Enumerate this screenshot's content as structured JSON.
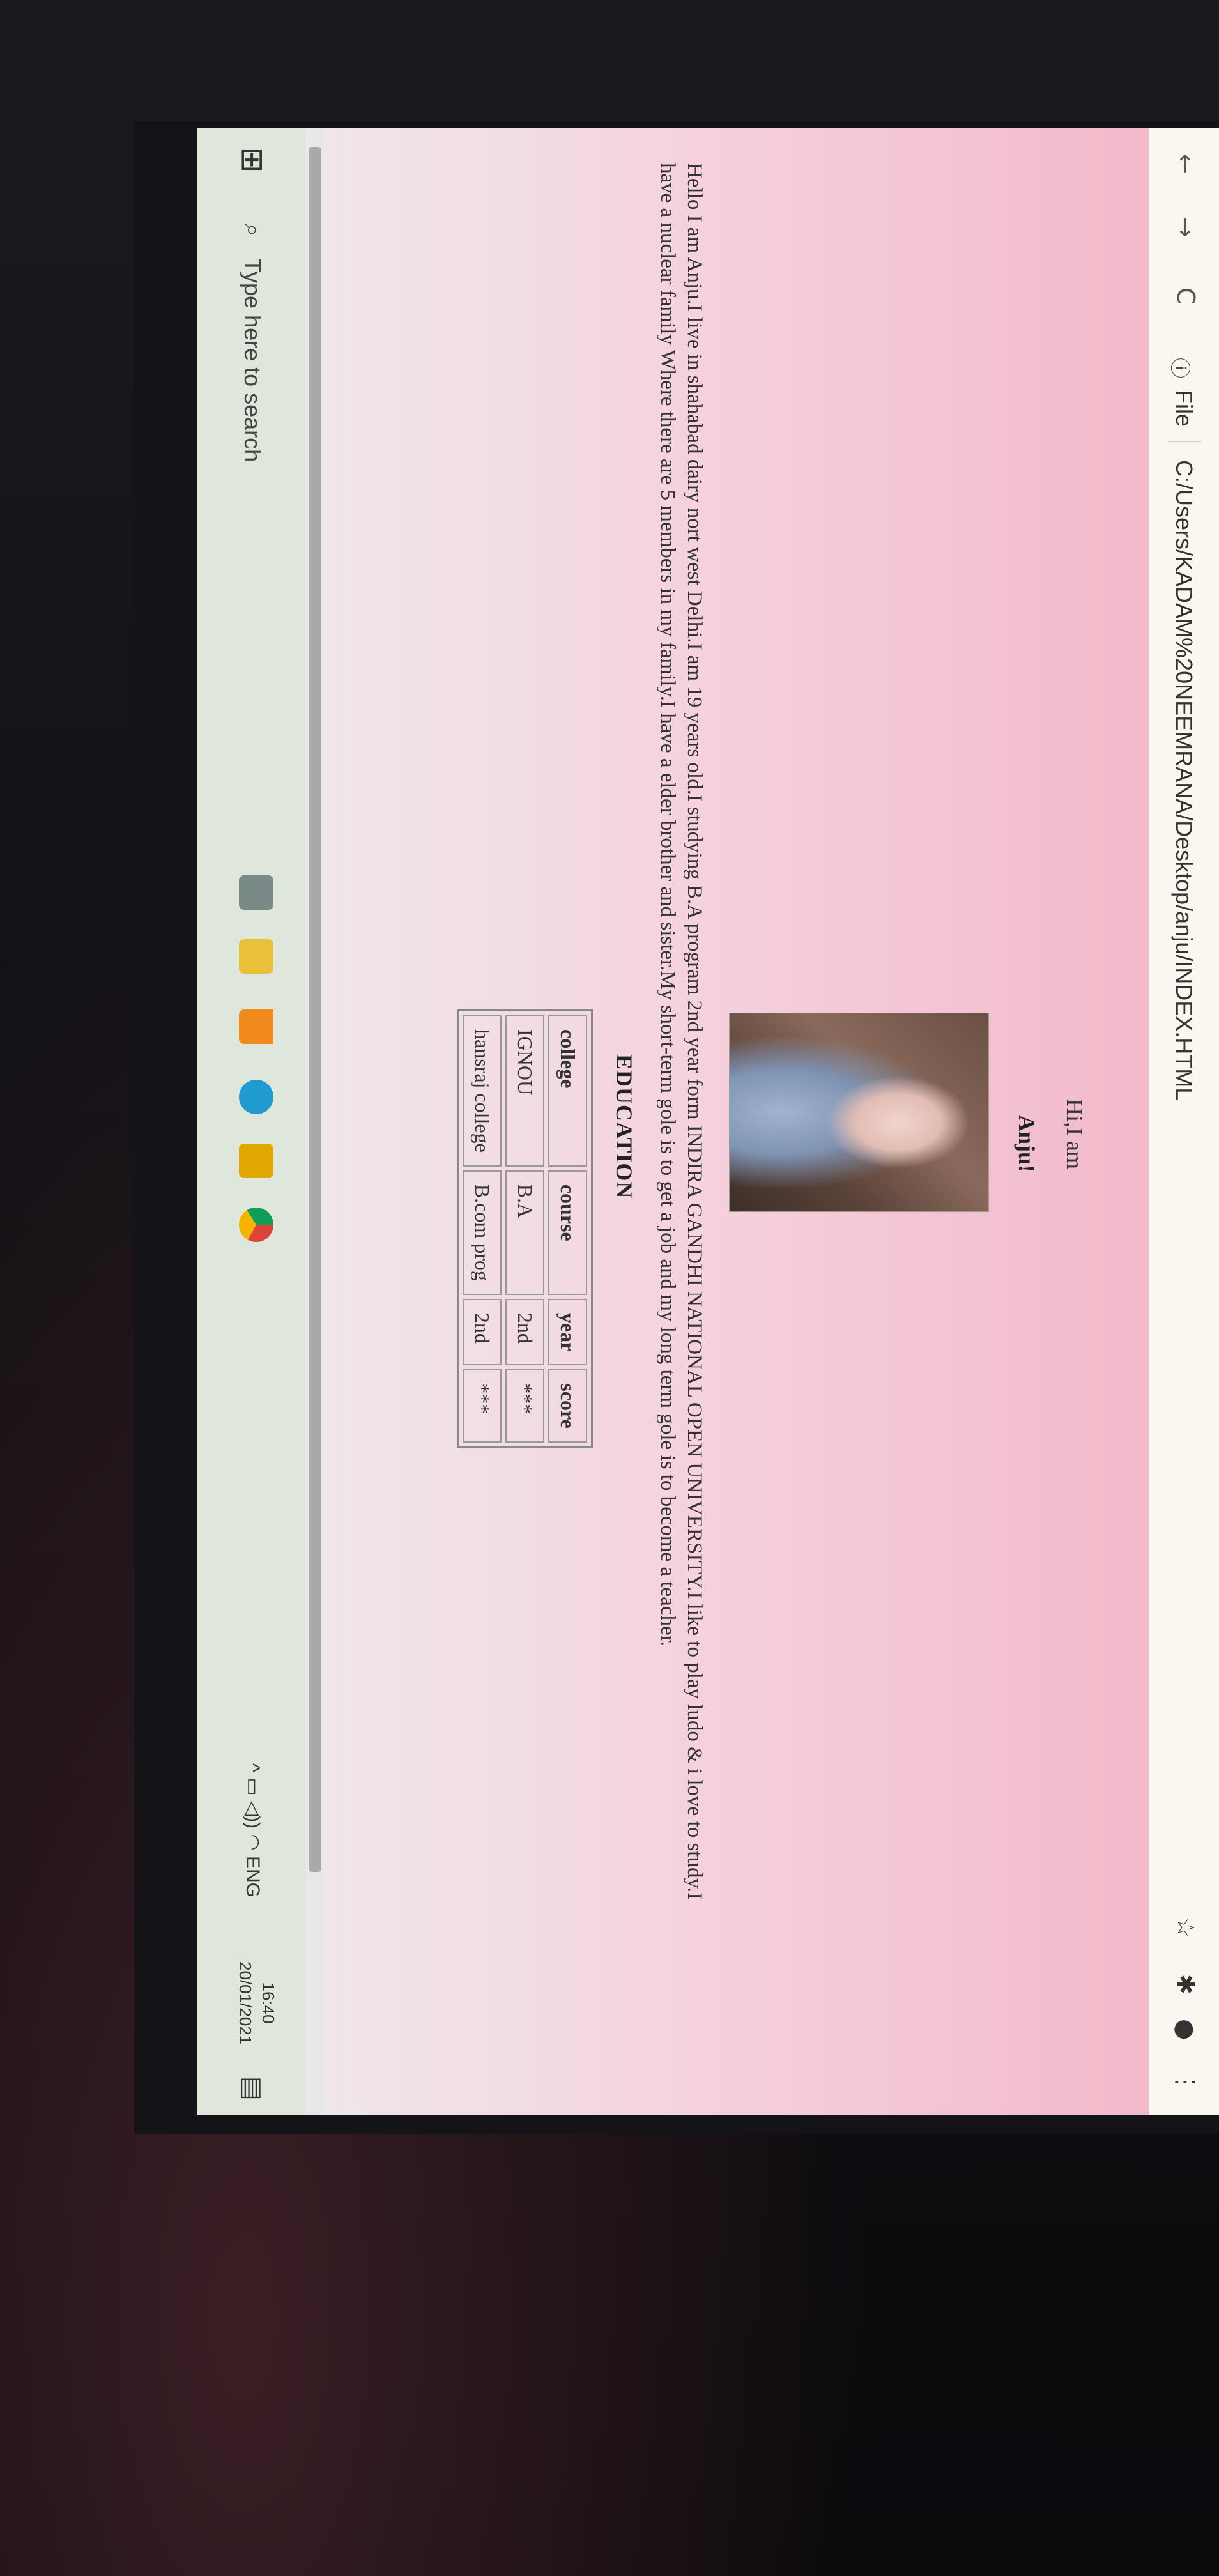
{
  "browser": {
    "back_icon": "←",
    "forward_icon": "→",
    "reload_icon": "C",
    "info_icon": "ⓘ",
    "protocol_label": "File",
    "url": "C:/Users/KADAM%20NEEMRANA/Desktop/anju/INDEX.HTML",
    "star_icon": "☆",
    "extensions_icon": "✱",
    "menu_icon": "⋮"
  },
  "page": {
    "greeting": "Hi,I am",
    "name": "Anju!",
    "bio": "Hello I am Anju.I live in shahabad dairy nort west Delhi.I am 19 years old.I studying B.A program 2nd year form INDIRA GANDHI NATIONAL OPEN UNIVERSITY.I like to play ludo & i love to study.I have a nuclear family Where there are 5 members in my family.I have a elder brother and sister.My short-term gole is to get a job and my long term gole is to become a teacher.",
    "education_heading": "EDUCATION",
    "table": {
      "headers": [
        "college",
        "course",
        "year",
        "score"
      ],
      "rows": [
        [
          "IGNOU",
          "B.A",
          "2nd",
          "***"
        ],
        [
          "hansraj college",
          "B.com prog",
          "2nd",
          "***"
        ]
      ]
    }
  },
  "taskbar": {
    "windows_icon": "⊞",
    "search_icon": "⌕",
    "search_placeholder": "Type here to search",
    "tray_icons": "^ ▭ ◁)) ◠ ENG",
    "time": "16:40",
    "date": "20/01/2021",
    "notification_icon": "▤"
  }
}
